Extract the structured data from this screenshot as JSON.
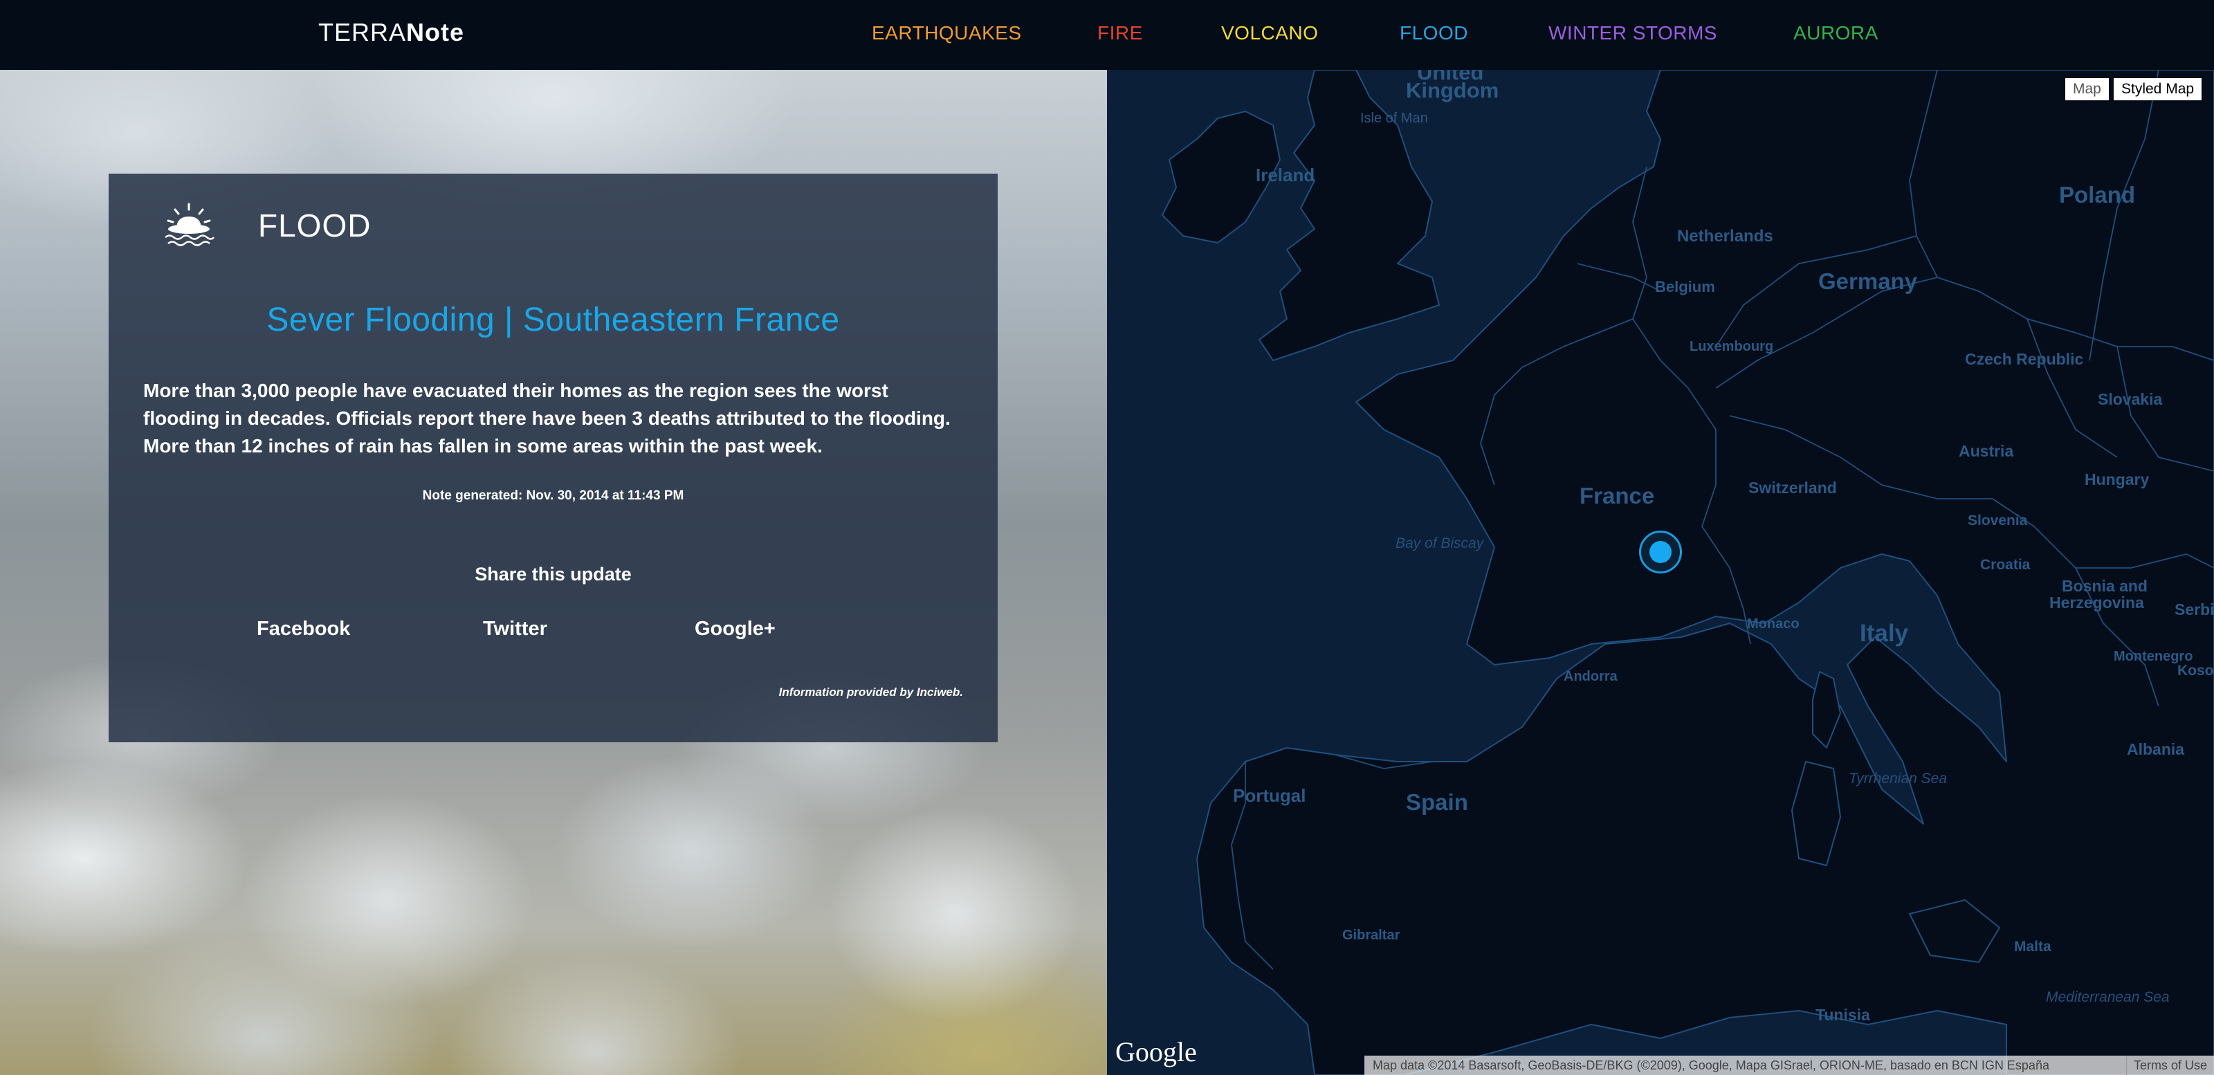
{
  "header": {
    "brand_light": "TERRA",
    "brand_bold": "Note",
    "nav": [
      {
        "label": "EARTHQUAKES",
        "color": "#f29a32"
      },
      {
        "label": "FIRE",
        "color": "#e2452d"
      },
      {
        "label": "VOLCANO",
        "color": "#f3d93a"
      },
      {
        "label": "FLOOD",
        "color": "#2aa4e0"
      },
      {
        "label": "WINTER STORMS",
        "color": "#9b5fe0"
      },
      {
        "label": "AURORA",
        "color": "#34b34a"
      }
    ]
  },
  "card": {
    "icon": "flood-weather-icon",
    "type": "FLOOD",
    "title": "Sever Flooding | Southeastern France",
    "body": "More than 3,000 people have evacuated their homes as the region sees the worst flooding in decades. Officials report there have been 3 deaths attributed to the flooding. More than 12 inches of rain has fallen in some areas within the past week.",
    "generated": "Note generated: Nov. 30, 2014 at 11:43 PM",
    "share_title": "Share this update",
    "share_links": [
      "Facebook",
      "Twitter",
      "Google+"
    ],
    "credit": "Information provided by Inciweb."
  },
  "map": {
    "type_buttons": [
      "Map",
      "Styled Map"
    ],
    "labels": {
      "united_kingdom_1": "United",
      "united_kingdom_2": "Kingdom",
      "isle_of_man": "Isle of Man",
      "ireland": "Ireland",
      "netherlands": "Netherlands",
      "belgium": "Belgium",
      "germany": "Germany",
      "luxembourg": "Luxembourg",
      "poland": "Poland",
      "czech_republic": "Czech Republic",
      "slovakia": "Slovakia",
      "france": "France",
      "austria": "Austria",
      "switzerland": "Switzerland",
      "hungary": "Hungary",
      "slovenia": "Slovenia",
      "croatia": "Croatia",
      "bay_of_biscay": "Bay of Biscay",
      "bosnia_1": "Bosnia and",
      "bosnia_2": "Herzegovina",
      "serbia": "Serbi",
      "monaco": "Monaco",
      "italy": "Italy",
      "andorra": "Andorra",
      "montenegro": "Montenegro",
      "kosovo": "Kosov",
      "albania": "Albania",
      "portugal": "Portugal",
      "spain": "Spain",
      "tyrrhenian_sea": "Tyrrhenian Sea",
      "gibraltar": "Gibraltar",
      "malta": "Malta",
      "mediterranean_sea": "Mediterranean Sea",
      "tunisia": "Tunisia"
    },
    "google_logo": "Google",
    "attribution": "Map data ©2014 Basarsoft, GeoBasis-DE/BKG (©2009), Google, Mapa GISrael, ORION-ME, basado en BCN IGN España",
    "terms": "Terms of Use"
  }
}
